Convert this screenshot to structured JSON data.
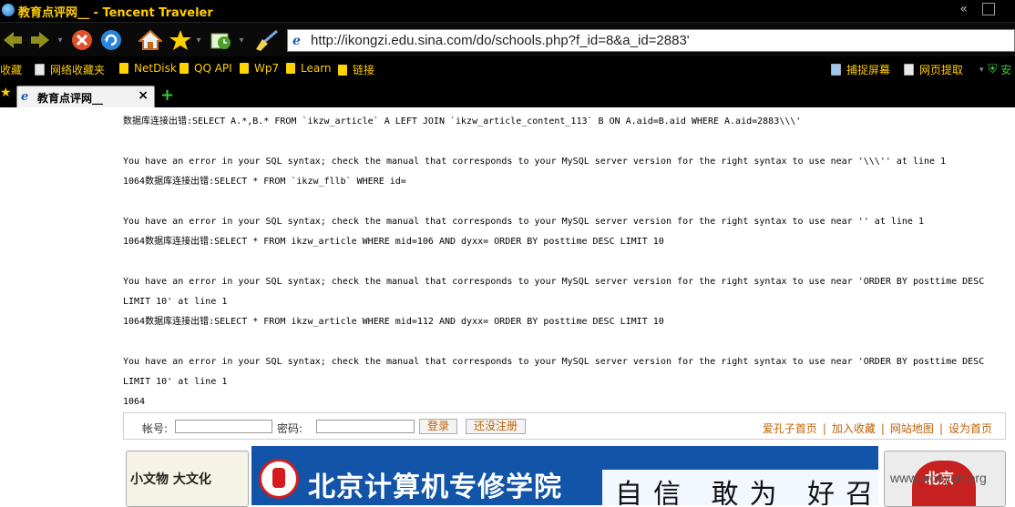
{
  "window": {
    "title": "教育点评网__ - Tencent Traveler"
  },
  "toolbar": {
    "back_icon": "back-arrow-icon",
    "forward_icon": "forward-arrow-icon",
    "stop_icon": "stop-icon",
    "refresh_icon": "refresh-icon",
    "home_icon": "home-icon",
    "favorites_icon": "star-icon",
    "history_icon": "history-icon",
    "clean_icon": "broom-icon",
    "address": "http://ikongzi.edu.sina.com/do/schools.php?f_id=8&a_id=2883'"
  },
  "favorites_bar": {
    "items": [
      {
        "label": "收藏"
      },
      {
        "label": "网络收藏夹"
      },
      {
        "label": "NetDisk"
      },
      {
        "label": "QQ API"
      },
      {
        "label": "Wp7"
      },
      {
        "label": "Learn"
      },
      {
        "label": "链接"
      }
    ],
    "right_items": [
      {
        "label": "捕捉屏幕"
      },
      {
        "label": "网页提取"
      },
      {
        "label": "安"
      }
    ]
  },
  "tabs": [
    {
      "label": "教育点评网__"
    }
  ],
  "page": {
    "error_text": "数据库连接出错:SELECT A.*,B.* FROM `ikzw_article` A LEFT JOIN `ikzw_article_content_113` B ON A.aid=B.aid WHERE A.aid=2883\\\\\\'\n\nYou have an error in your SQL syntax; check the manual that corresponds to your MySQL server version for the right syntax to use near '\\\\\\'' at line 1\n1064数据库连接出错:SELECT * FROM `ikzw_fllb` WHERE id=\n\nYou have an error in your SQL syntax; check the manual that corresponds to your MySQL server version for the right syntax to use near '' at line 1\n1064数据库连接出错:SELECT * FROM ikzw_article WHERE mid=106 AND dyxx= ORDER BY posttime DESC LIMIT 10\n\nYou have an error in your SQL syntax; check the manual that corresponds to your MySQL server version for the right syntax to use near 'ORDER BY posttime DESC LIMIT 10' at line 1\n1064数据库连接出错:SELECT * FROM ikzw_article WHERE mid=112 AND dyxx= ORDER BY posttime DESC LIMIT 10\n\nYou have an error in your SQL syntax; check the manual that corresponds to your MySQL server version for the right syntax to use near 'ORDER BY posttime DESC LIMIT 10' at line 1\n1064",
    "login": {
      "account_label": "帐号:",
      "password_label": "密码:",
      "login_button": "登录",
      "register_button": "还没注册"
    },
    "links": [
      {
        "label": "爱孔子首页"
      },
      {
        "label": "加入收藏"
      },
      {
        "label": "网站地图"
      },
      {
        "label": "设为首页"
      }
    ],
    "banners": {
      "left_text": "小文物 大文化",
      "mid_text": "北京计算机专修学院",
      "mid_slogan": "自信 敢为 好召",
      "right_text": "北京"
    },
    "watermark": "www.wooyun.org"
  }
}
